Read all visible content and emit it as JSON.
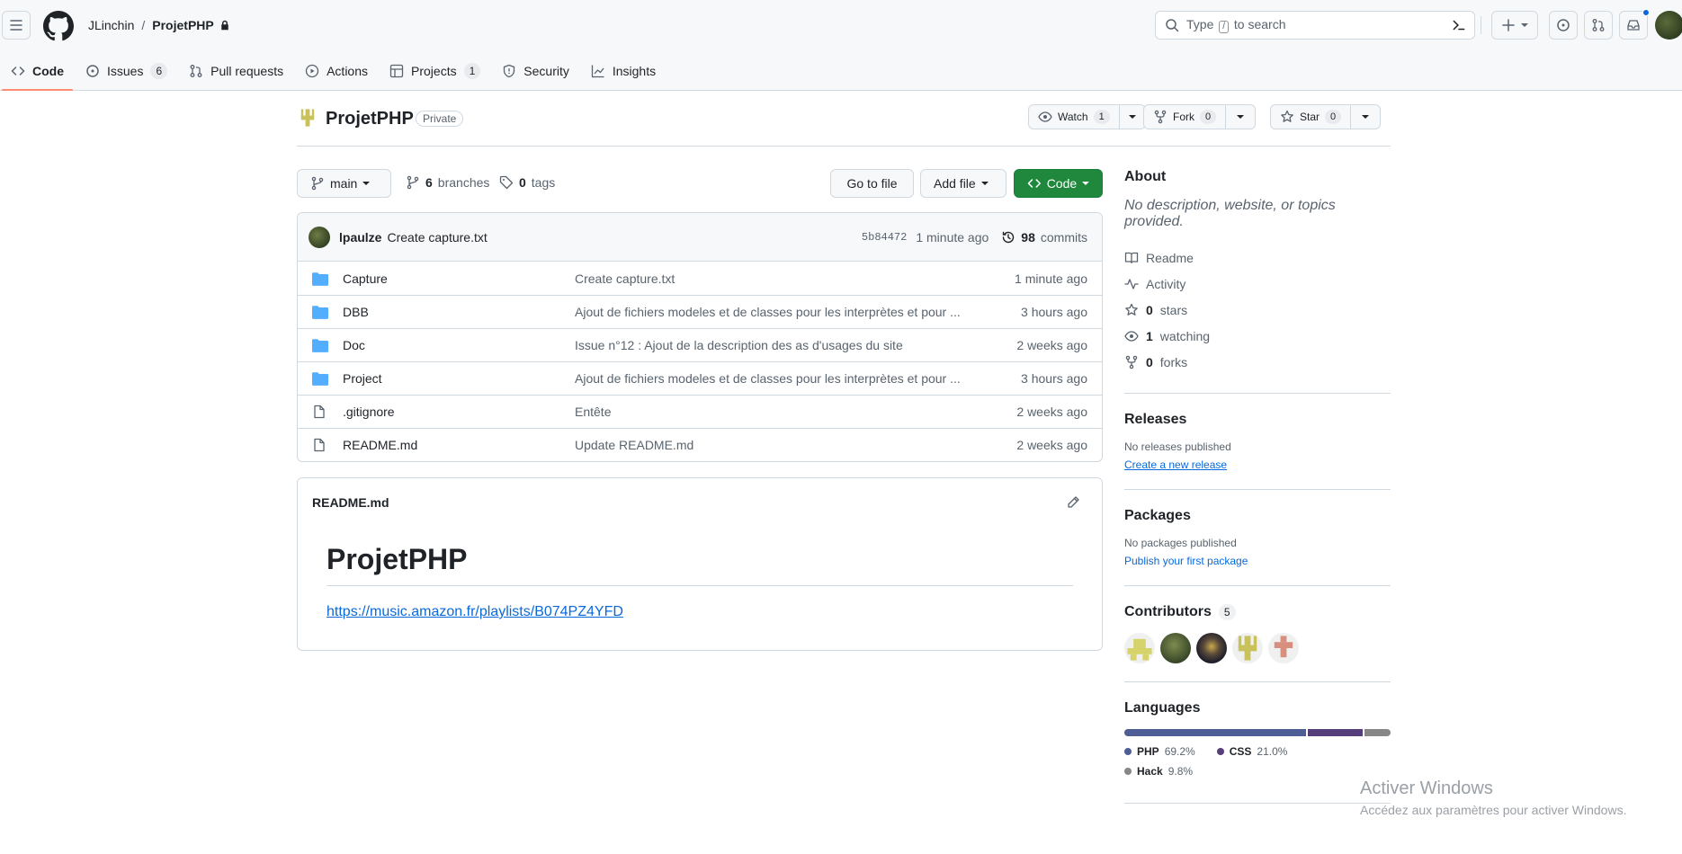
{
  "header": {
    "owner": "JLinchin",
    "separator": "/",
    "repo": "ProjetPHP",
    "search_prefix": "Type",
    "search_key": "/",
    "search_suffix": "to search"
  },
  "tabs": [
    {
      "label": "Code",
      "icon": "code-icon"
    },
    {
      "label": "Issues",
      "count": "6",
      "icon": "issue-icon"
    },
    {
      "label": "Pull requests",
      "icon": "pull-request-icon"
    },
    {
      "label": "Actions",
      "icon": "play-icon"
    },
    {
      "label": "Projects",
      "count": "1",
      "icon": "table-icon"
    },
    {
      "label": "Security",
      "icon": "shield-icon"
    },
    {
      "label": "Insights",
      "icon": "graph-icon"
    }
  ],
  "repo": {
    "name": "ProjetPHP",
    "visibility": "Private",
    "watch_label": "Watch",
    "watch_count": "1",
    "fork_label": "Fork",
    "fork_count": "0",
    "star_label": "Star",
    "star_count": "0"
  },
  "branchbar": {
    "branch": "main",
    "branches_count": "6",
    "branches_label": "branches",
    "tags_count": "0",
    "tags_label": "tags",
    "goto_file": "Go to file",
    "add_file": "Add file",
    "code": "Code"
  },
  "commit": {
    "author": "lpaulze",
    "message": "Create capture.txt",
    "sha": "5b84472",
    "time": "1 minute ago",
    "commits_count": "98",
    "commits_label": "commits"
  },
  "files": [
    {
      "type": "folder",
      "name": "Capture",
      "message": "Create capture.txt",
      "age": "1 minute ago"
    },
    {
      "type": "folder",
      "name": "DBB",
      "message": "Ajout de fichiers modeles et de classes pour les interprètes et pour ...",
      "age": "3 hours ago"
    },
    {
      "type": "folder",
      "name": "Doc",
      "message": "Issue n°12 : Ajout de la description des as d'usages du site",
      "age": "2 weeks ago"
    },
    {
      "type": "folder",
      "name": "Project",
      "message": "Ajout de fichiers modeles et de classes pour les interprètes et pour ...",
      "age": "3 hours ago"
    },
    {
      "type": "file",
      "name": ".gitignore",
      "message": "Entête",
      "age": "2 weeks ago"
    },
    {
      "type": "file",
      "name": "README.md",
      "message": "Update README.md",
      "age": "2 weeks ago"
    }
  ],
  "readme": {
    "filename": "README.md",
    "heading": "ProjetPHP",
    "link": "https://music.amazon.fr/playlists/B074PZ4YFD"
  },
  "sidebar": {
    "about_title": "About",
    "about_desc": "No description, website, or topics provided.",
    "about_items": [
      {
        "icon": "book-icon",
        "value": "",
        "label": "Readme"
      },
      {
        "icon": "pulse-icon",
        "value": "",
        "label": "Activity"
      },
      {
        "icon": "star-icon",
        "value": "0",
        "label": "stars"
      },
      {
        "icon": "eye-icon",
        "value": "1",
        "label": "watching"
      },
      {
        "icon": "fork-icon",
        "value": "0",
        "label": "forks"
      }
    ],
    "releases_title": "Releases",
    "releases_none": "No releases published",
    "releases_link": "Create a new release",
    "packages_title": "Packages",
    "packages_none": "No packages published",
    "packages_link": "Publish your first package",
    "contributors_title": "Contributors",
    "contributors_count": "5",
    "languages_title": "Languages",
    "languages": [
      {
        "name": "PHP",
        "percent": "69.2%",
        "value": 69.2,
        "color": "#4F5D95"
      },
      {
        "name": "CSS",
        "percent": "21.0%",
        "value": 21.0,
        "color": "#563d7c"
      },
      {
        "name": "Hack",
        "percent": "9.8%",
        "value": 9.8,
        "color": "#878787"
      }
    ]
  },
  "watermark": {
    "title": "Activer Windows",
    "subtitle": "Accédez aux paramètres pour activer Windows."
  },
  "colors": {
    "accent_green": "#1f883d",
    "link_blue": "#0969da",
    "folder_blue": "#54aeff",
    "tab_underline": "#fd8c73"
  }
}
